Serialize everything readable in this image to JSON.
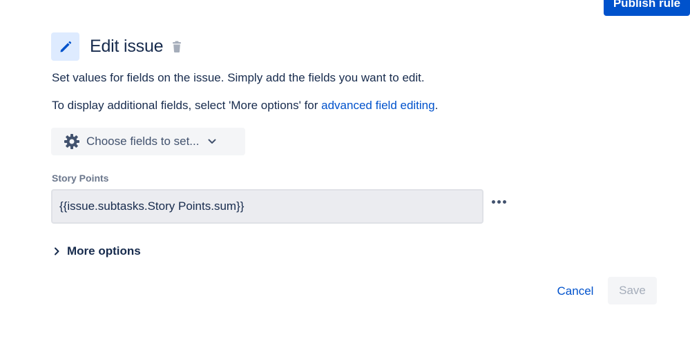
{
  "header_actions": {
    "publish_label": "Publish rule"
  },
  "action": {
    "title": "Edit issue",
    "icon": "pencil-icon",
    "delete_icon": "trash-icon",
    "description": "Set values for fields on the issue. Simply add the fields you want to edit.",
    "advanced_prefix": "To display additional fields, select 'More options' for ",
    "advanced_link": "advanced field editing",
    "advanced_suffix": "."
  },
  "field_chooser": {
    "label": "Choose fields to set...",
    "icon": "gear-icon",
    "chevron_icon": "chevron-down-icon"
  },
  "fields": [
    {
      "label": "Story Points",
      "value": "{{issue.subtasks.Story Points.sum}}"
    }
  ],
  "more_options": {
    "label": "More options",
    "icon": "chevron-right-icon"
  },
  "footer": {
    "cancel_label": "Cancel",
    "save_label": "Save"
  },
  "colors": {
    "primary": "#0052cc",
    "text": "#172b4d",
    "subtle": "#6b778c",
    "tile": "#deebff"
  }
}
